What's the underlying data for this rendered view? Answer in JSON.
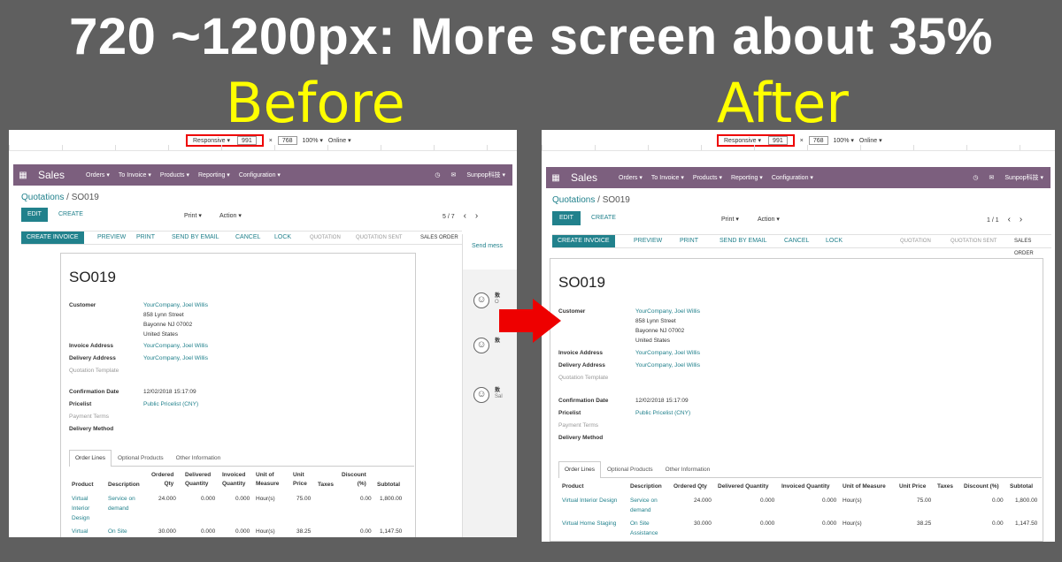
{
  "headline": "720 ~1200px: More screen about 35%",
  "before_label": "Before",
  "after_label": "After",
  "devtools": {
    "mode": "Responsive",
    "width": "991",
    "x": "×",
    "height": "768",
    "zoom": "100%",
    "network": "Online"
  },
  "nav": {
    "brand": "Sales",
    "menus": [
      "Orders",
      "To Invoice",
      "Products",
      "Reporting",
      "Configuration"
    ],
    "user": "Sunpop科技"
  },
  "breadcrumb": {
    "parent": "Quotations",
    "sep": "/",
    "current": "SO019"
  },
  "buttons": {
    "edit": "EDIT",
    "create": "CREATE",
    "print": "Print",
    "action": "Action"
  },
  "pager": {
    "before": "5 / 7",
    "after": "1 / 1"
  },
  "statusbar": {
    "actions": [
      "CREATE INVOICE",
      "PREVIEW",
      "PRINT",
      "SEND BY EMAIL",
      "CANCEL",
      "LOCK"
    ],
    "stages": [
      "QUOTATION",
      "QUOTATION SENT",
      "SALES ORDER"
    ]
  },
  "order": {
    "title": "SO019",
    "customer_label": "Customer",
    "customer_name": "YourCompany, Joel Willis",
    "customer_addr1": "858 Lynn Street",
    "customer_addr2": "Bayonne NJ 07002",
    "customer_addr3": "United States",
    "invoice_label": "Invoice Address",
    "invoice_value": "YourCompany, Joel Willis",
    "delivery_label": "Delivery Address",
    "delivery_value": "YourCompany, Joel Willis",
    "template_label": "Quotation Template",
    "confirm_label": "Confirmation Date",
    "confirm_value": "12/02/2018 15:17:09",
    "pricelist_label": "Pricelist",
    "pricelist_value": "Public Pricelist (CNY)",
    "payment_label": "Payment Terms",
    "delivery_method_label": "Delivery Method"
  },
  "tabs": [
    "Order Lines",
    "Optional Products",
    "Other Information"
  ],
  "before_table": {
    "headers": [
      [
        "Product"
      ],
      [
        "Description"
      ],
      [
        "Ordered",
        "Qty"
      ],
      [
        "Delivered",
        "Quantity"
      ],
      [
        "Invoiced",
        "Quantity"
      ],
      [
        "Unit of",
        "Measure"
      ],
      [
        "Unit",
        "Price"
      ],
      [
        "Taxes"
      ],
      [
        "Discount",
        "(%)"
      ],
      [
        "Subtotal"
      ]
    ],
    "rows": [
      {
        "product": [
          "Virtual",
          "Interior",
          "Design"
        ],
        "desc": [
          "Service on",
          "demand"
        ],
        "qty": "24.000",
        "delivered": "0.000",
        "invoiced": "0.000",
        "uom": "Hour(s)",
        "price": "75.00",
        "discount": "0.00",
        "subtotal": "1,800.00"
      },
      {
        "product": [
          "Virtual"
        ],
        "desc": [
          "On Site"
        ],
        "qty": "30.000",
        "delivered": "0.000",
        "invoiced": "0.000",
        "uom": "Hour(s)",
        "price": "38.25",
        "discount": "0.00",
        "subtotal": "1,147.50"
      }
    ]
  },
  "after_table": {
    "headers": [
      "Product",
      "Description",
      "Ordered Qty",
      "Delivered Quantity",
      "Invoiced Quantity",
      "Unit of Measure",
      "Unit Price",
      "Taxes",
      "Discount (%)",
      "Subtotal"
    ],
    "rows": [
      {
        "product": "Virtual Interior Design",
        "desc": [
          "Service on",
          "demand"
        ],
        "qty": "24.000",
        "delivered": "0.000",
        "invoiced": "0.000",
        "uom": "Hour(s)",
        "price": "75.00",
        "discount": "0.00",
        "subtotal": "1,800.00"
      },
      {
        "product": "Virtual Home Staging",
        "desc": [
          "On Site",
          "Assistance"
        ],
        "qty": "30.000",
        "delivered": "0.000",
        "invoiced": "0.000",
        "uom": "Hour(s)",
        "price": "38.25",
        "discount": "0.00",
        "subtotal": "1,147.50"
      }
    ]
  },
  "chatter": {
    "send": "Send mess",
    "entries": [
      {
        "name": "敖",
        "sub": "O"
      },
      {
        "name": "敖",
        "sub": ""
      },
      {
        "name": "敖",
        "sub": "Sal"
      }
    ]
  },
  "colors": {
    "navbar": "#7c5f7e",
    "primary": "#21818c",
    "highlight": "#ee0000",
    "headline": "#ffffff",
    "label": "#ffff00"
  }
}
